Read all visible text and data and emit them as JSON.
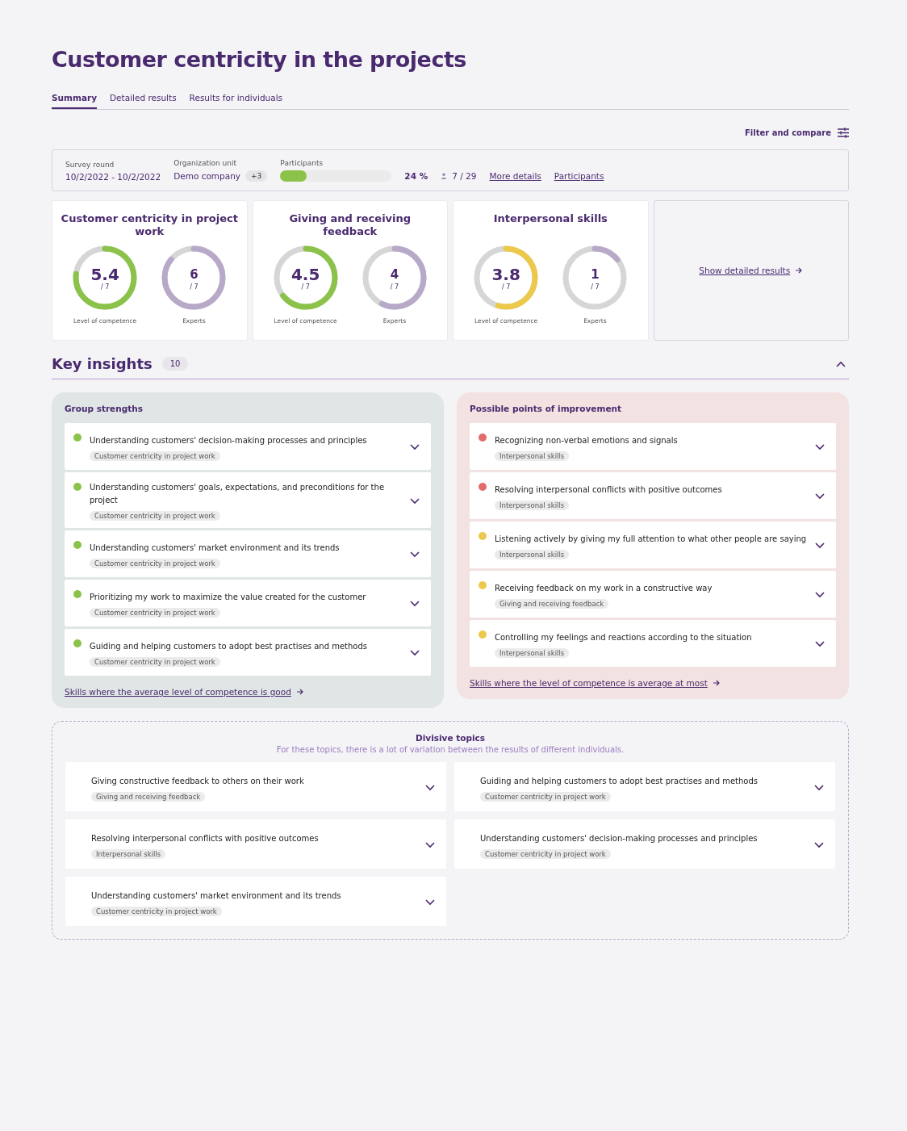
{
  "title": "Customer centricity in the projects",
  "tabs": [
    {
      "label": "Summary",
      "selected": true
    },
    {
      "label": "Detailed results",
      "selected": false
    },
    {
      "label": "Results for individuals",
      "selected": false
    }
  ],
  "filter_button": "Filter and compare",
  "info": {
    "survey_round": {
      "label": "Survey round",
      "value": "10/2/2022 - 10/2/2022"
    },
    "organization_unit": {
      "label": "Organization unit",
      "value": "Demo company",
      "extra": "+3"
    },
    "participants": {
      "label": "Participants",
      "level": 0.24,
      "percent": "24 %",
      "count": "7 / 29"
    },
    "links": [
      "More details",
      "Participants"
    ]
  },
  "cards": [
    {
      "title": "Customer centricity in project work",
      "gauges": [
        {
          "value": "5.4",
          "max": "/ 7",
          "label": "Level of competence",
          "level": 0.77,
          "color": "#8bc34a"
        },
        {
          "value": "6",
          "max": "/ 7",
          "label": "Experts",
          "level": 0.857,
          "color": "#b8a9c9"
        }
      ]
    },
    {
      "title": "Giving and receiving feedback",
      "gauges": [
        {
          "value": "4.5",
          "max": "/ 7",
          "label": "Level of competence",
          "level": 0.643,
          "color": "#8bc34a"
        },
        {
          "value": "4",
          "max": "/ 7",
          "label": "Experts",
          "level": 0.571,
          "color": "#b8a9c9"
        }
      ]
    },
    {
      "title": "Interpersonal skills",
      "gauges": [
        {
          "value": "3.8",
          "max": "/ 7",
          "label": "Level of competence",
          "level": 0.543,
          "color": "#ecc94b"
        },
        {
          "value": "1",
          "max": "/ 7",
          "label": "Experts",
          "level": 0.143,
          "color": "#b8a9c9"
        }
      ]
    }
  ],
  "show_detailed_results": "Show detailed results",
  "key_insights": {
    "title": "Key insights",
    "count": "10",
    "expanded": true
  },
  "strengths": {
    "title": "Group strengths",
    "items": [
      {
        "text": "Understanding customers' decision-making processes and principles",
        "tag": "Customer centricity in project work",
        "color": "#8bc34a"
      },
      {
        "text": "Understanding customers' goals, expectations, and preconditions for the project",
        "tag": "Customer centricity in project work",
        "color": "#8bc34a"
      },
      {
        "text": "Understanding customers' market environment and its trends",
        "tag": "Customer centricity in project work",
        "color": "#8bc34a"
      },
      {
        "text": "Prioritizing my work to maximize the value created for the customer",
        "tag": "Customer centricity in project work",
        "color": "#8bc34a"
      },
      {
        "text": "Guiding and helping customers to adopt best practises and methods",
        "tag": "Customer centricity in project work",
        "color": "#8bc34a"
      }
    ],
    "link": "Skills where the average level of competence is good"
  },
  "improvements": {
    "title": "Possible points of improvement",
    "items": [
      {
        "text": "Recognizing non-verbal emotions and signals",
        "tag": "Interpersonal skills",
        "color": "#e36b6b"
      },
      {
        "text": "Resolving interpersonal conflicts with positive outcomes",
        "tag": "Interpersonal skills",
        "color": "#e36b6b"
      },
      {
        "text": "Listening actively by giving my full attention to what other people are saying",
        "tag": "Interpersonal skills",
        "color": "#ecc94b"
      },
      {
        "text": "Receiving feedback on my work in a constructive way",
        "tag": "Giving and receiving feedback",
        "color": "#ecc94b"
      },
      {
        "text": "Controlling my feelings and reactions according to the situation",
        "tag": "Interpersonal skills",
        "color": "#ecc94b"
      }
    ],
    "link": "Skills where the level of competence is average at most"
  },
  "divisive": {
    "title": "Divisive topics",
    "subtitle": "For these topics, there is a lot of variation between the results of different individuals.",
    "items": [
      {
        "text": "Giving constructive feedback to others on their work",
        "tag": "Giving and receiving feedback"
      },
      {
        "text": "Guiding and helping customers to adopt best practises and methods",
        "tag": "Customer centricity in project work"
      },
      {
        "text": "Resolving interpersonal conflicts with positive outcomes",
        "tag": "Interpersonal skills"
      },
      {
        "text": "Understanding customers' decision-making processes and principles",
        "tag": "Customer centricity in project work"
      },
      {
        "text": "Understanding customers' market environment and its trends",
        "tag": "Customer centricity in project work"
      }
    ]
  }
}
